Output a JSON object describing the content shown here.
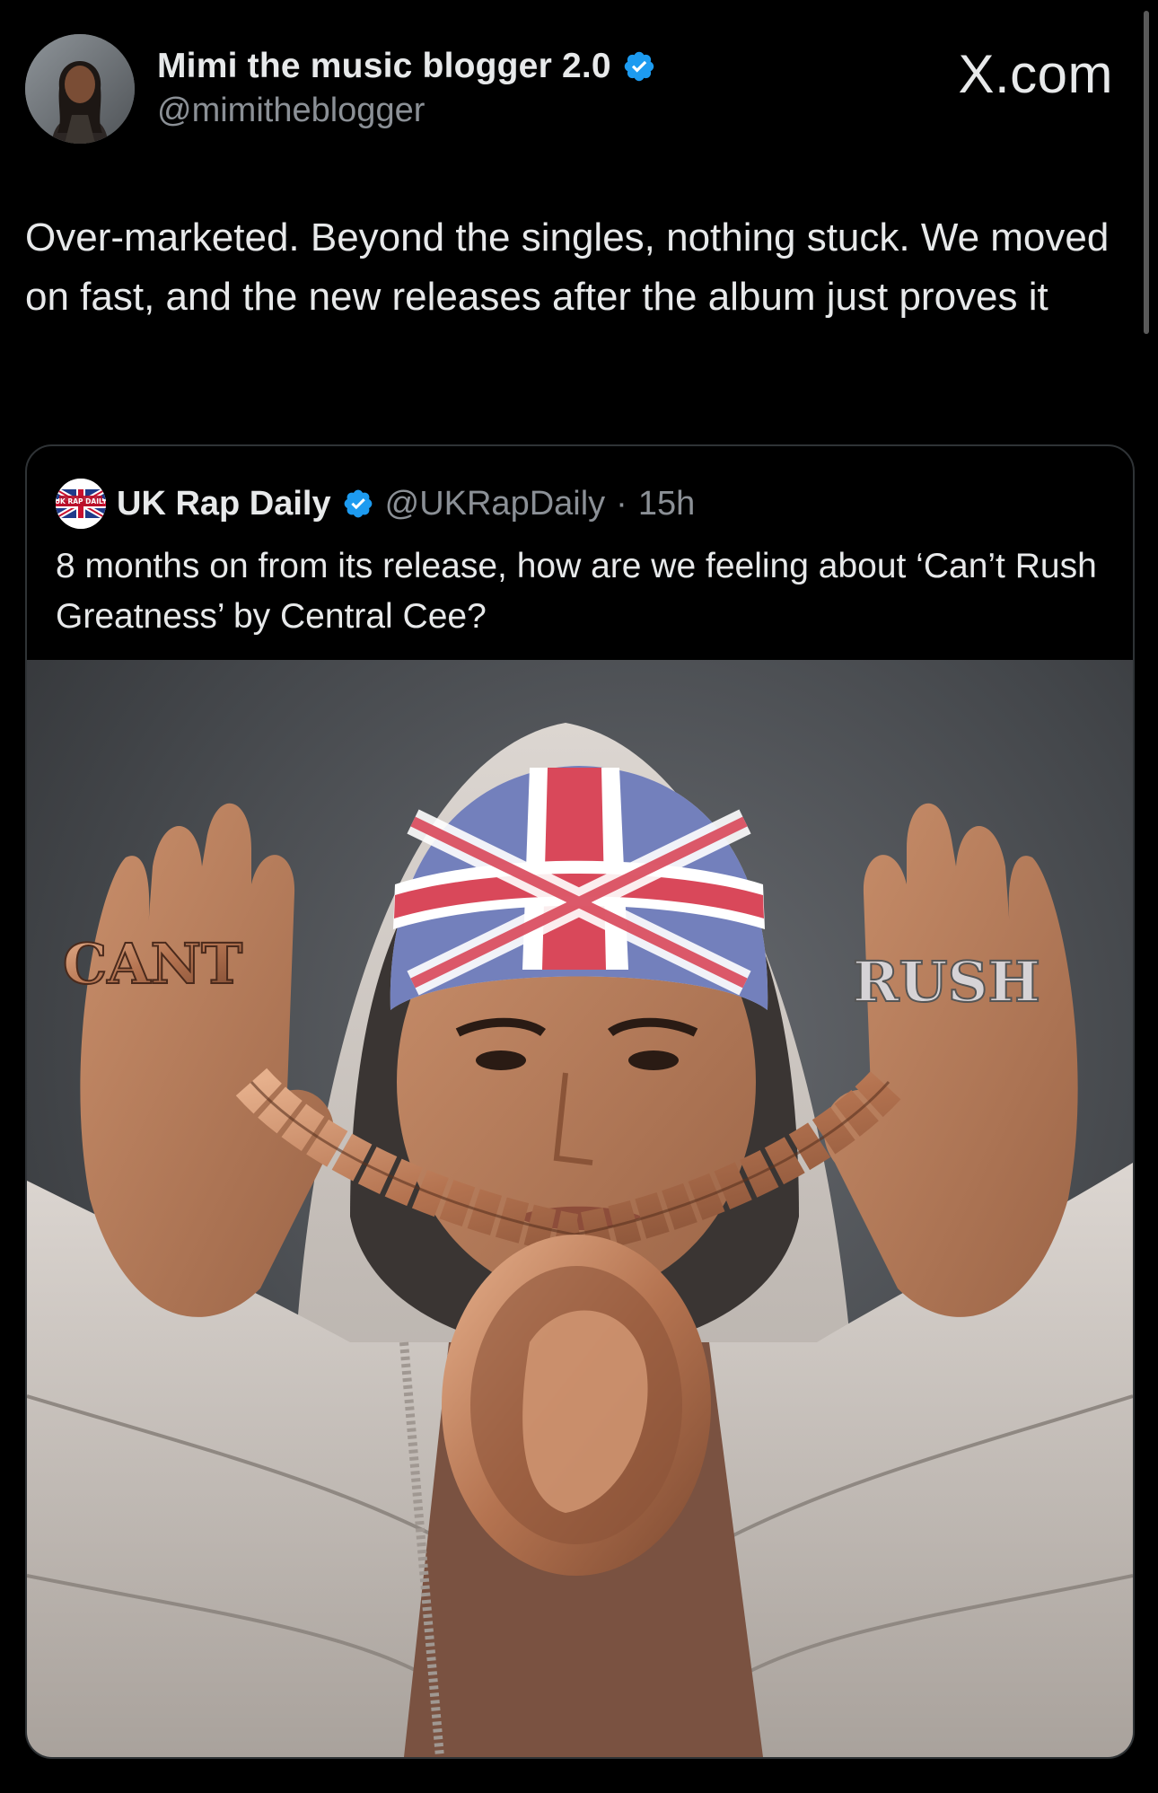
{
  "author": {
    "display_name": "Mimi the music blogger 2.0",
    "handle": "@mimitheblogger",
    "verified": true,
    "avatar_icon": "profile-photo"
  },
  "brand": {
    "label": "X.com"
  },
  "tweet": {
    "text": "Over-marketed. Beyond the singles, nothing stuck. We moved on fast, and the new releases after the album just proves it"
  },
  "quoted_tweet": {
    "display_name": "UK Rap Daily",
    "handle": "@UKRapDaily",
    "separator": "·",
    "time": "15h",
    "verified": true,
    "avatar_text": "UK RAP DAILY",
    "text": "8 months on from its release, how are we feeling about ‘Can’t Rush Greatness’ by Central Cee?",
    "image": {
      "ring_left_text": "CANT",
      "ring_right_text": "RUSH"
    }
  },
  "colors": {
    "background": "#000000",
    "text_primary": "#e7e9ea",
    "text_secondary": "#8b9096",
    "verified_blue": "#1d9bf0",
    "border": "#2f3336"
  }
}
